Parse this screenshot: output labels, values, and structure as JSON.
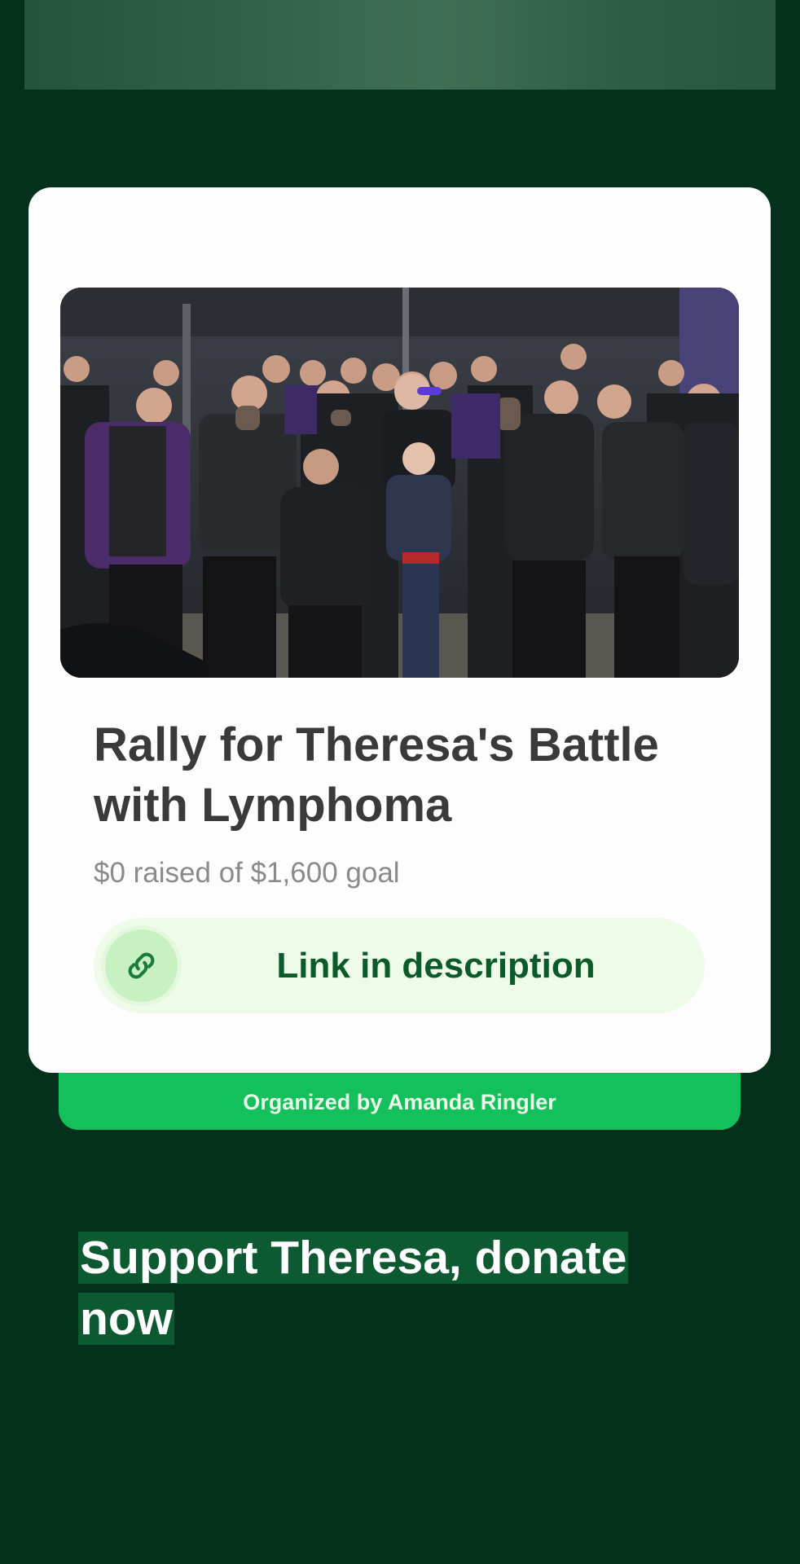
{
  "campaign": {
    "title": "Rally for Theresa's Battle with Lymphoma",
    "progress": "$0 raised of $1,600 goal",
    "raised": 0,
    "goal": 1600,
    "photo_alt": "Group photo of supporters in leather vests standing in front of a storefront"
  },
  "link_button": {
    "label": "Link in description",
    "icon": "link-icon"
  },
  "organizer": {
    "text": "Organized by Amanda Ringler"
  },
  "cta": {
    "text": "Support Theresa, donate now"
  },
  "colors": {
    "background": "#04301c",
    "card": "#fdfdfd",
    "brand_green": "#13c05b",
    "link_pill": "#edfbe8",
    "link_text": "#0b5a2a",
    "cta_highlight": "#0d5a32"
  }
}
